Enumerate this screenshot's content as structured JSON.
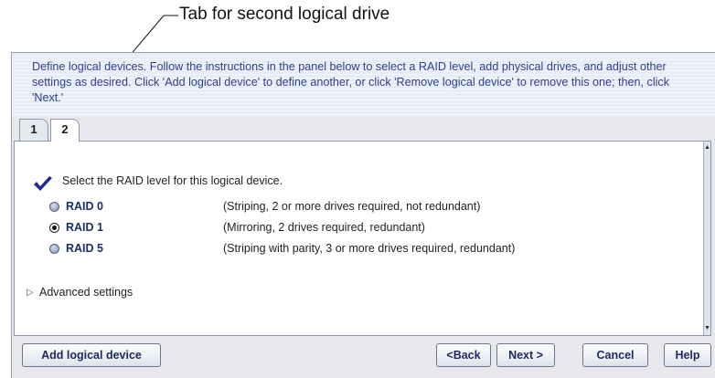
{
  "callout": {
    "text": "Tab for second logical drive"
  },
  "instructions": "Define logical devices.  Follow the instructions in the panel below to select a RAID level, add physical drives, and adjust other settings as desired.  Click 'Add logical device' to define another, or click 'Remove logical device' to remove this one; then, click 'Next.'",
  "tabs": [
    {
      "label": "1",
      "active": false
    },
    {
      "label": "2",
      "active": true
    }
  ],
  "panel": {
    "prompt": "Select the RAID level for this logical device.",
    "raid_options": [
      {
        "name": "RAID 0",
        "description": "(Striping, 2 or more drives required, not redundant)",
        "selected": false
      },
      {
        "name": "RAID 1",
        "description": "(Mirroring, 2 drives required, redundant)",
        "selected": true
      },
      {
        "name": "RAID 5",
        "description": "(Striping with parity, 3 or more drives required, redundant)",
        "selected": false
      }
    ],
    "advanced_label": "Advanced settings"
  },
  "buttons": {
    "add_logical_device": "Add logical device",
    "back": "<Back",
    "next": "Next >",
    "cancel": "Cancel",
    "help": "Help"
  },
  "colors": {
    "accent": "#1e2f63",
    "instruction_text": "#30408d",
    "checkmark": "#1f2d8a"
  },
  "icons": {
    "checkmark": "checkmark-icon",
    "disclosure": "triangle-right-icon"
  }
}
